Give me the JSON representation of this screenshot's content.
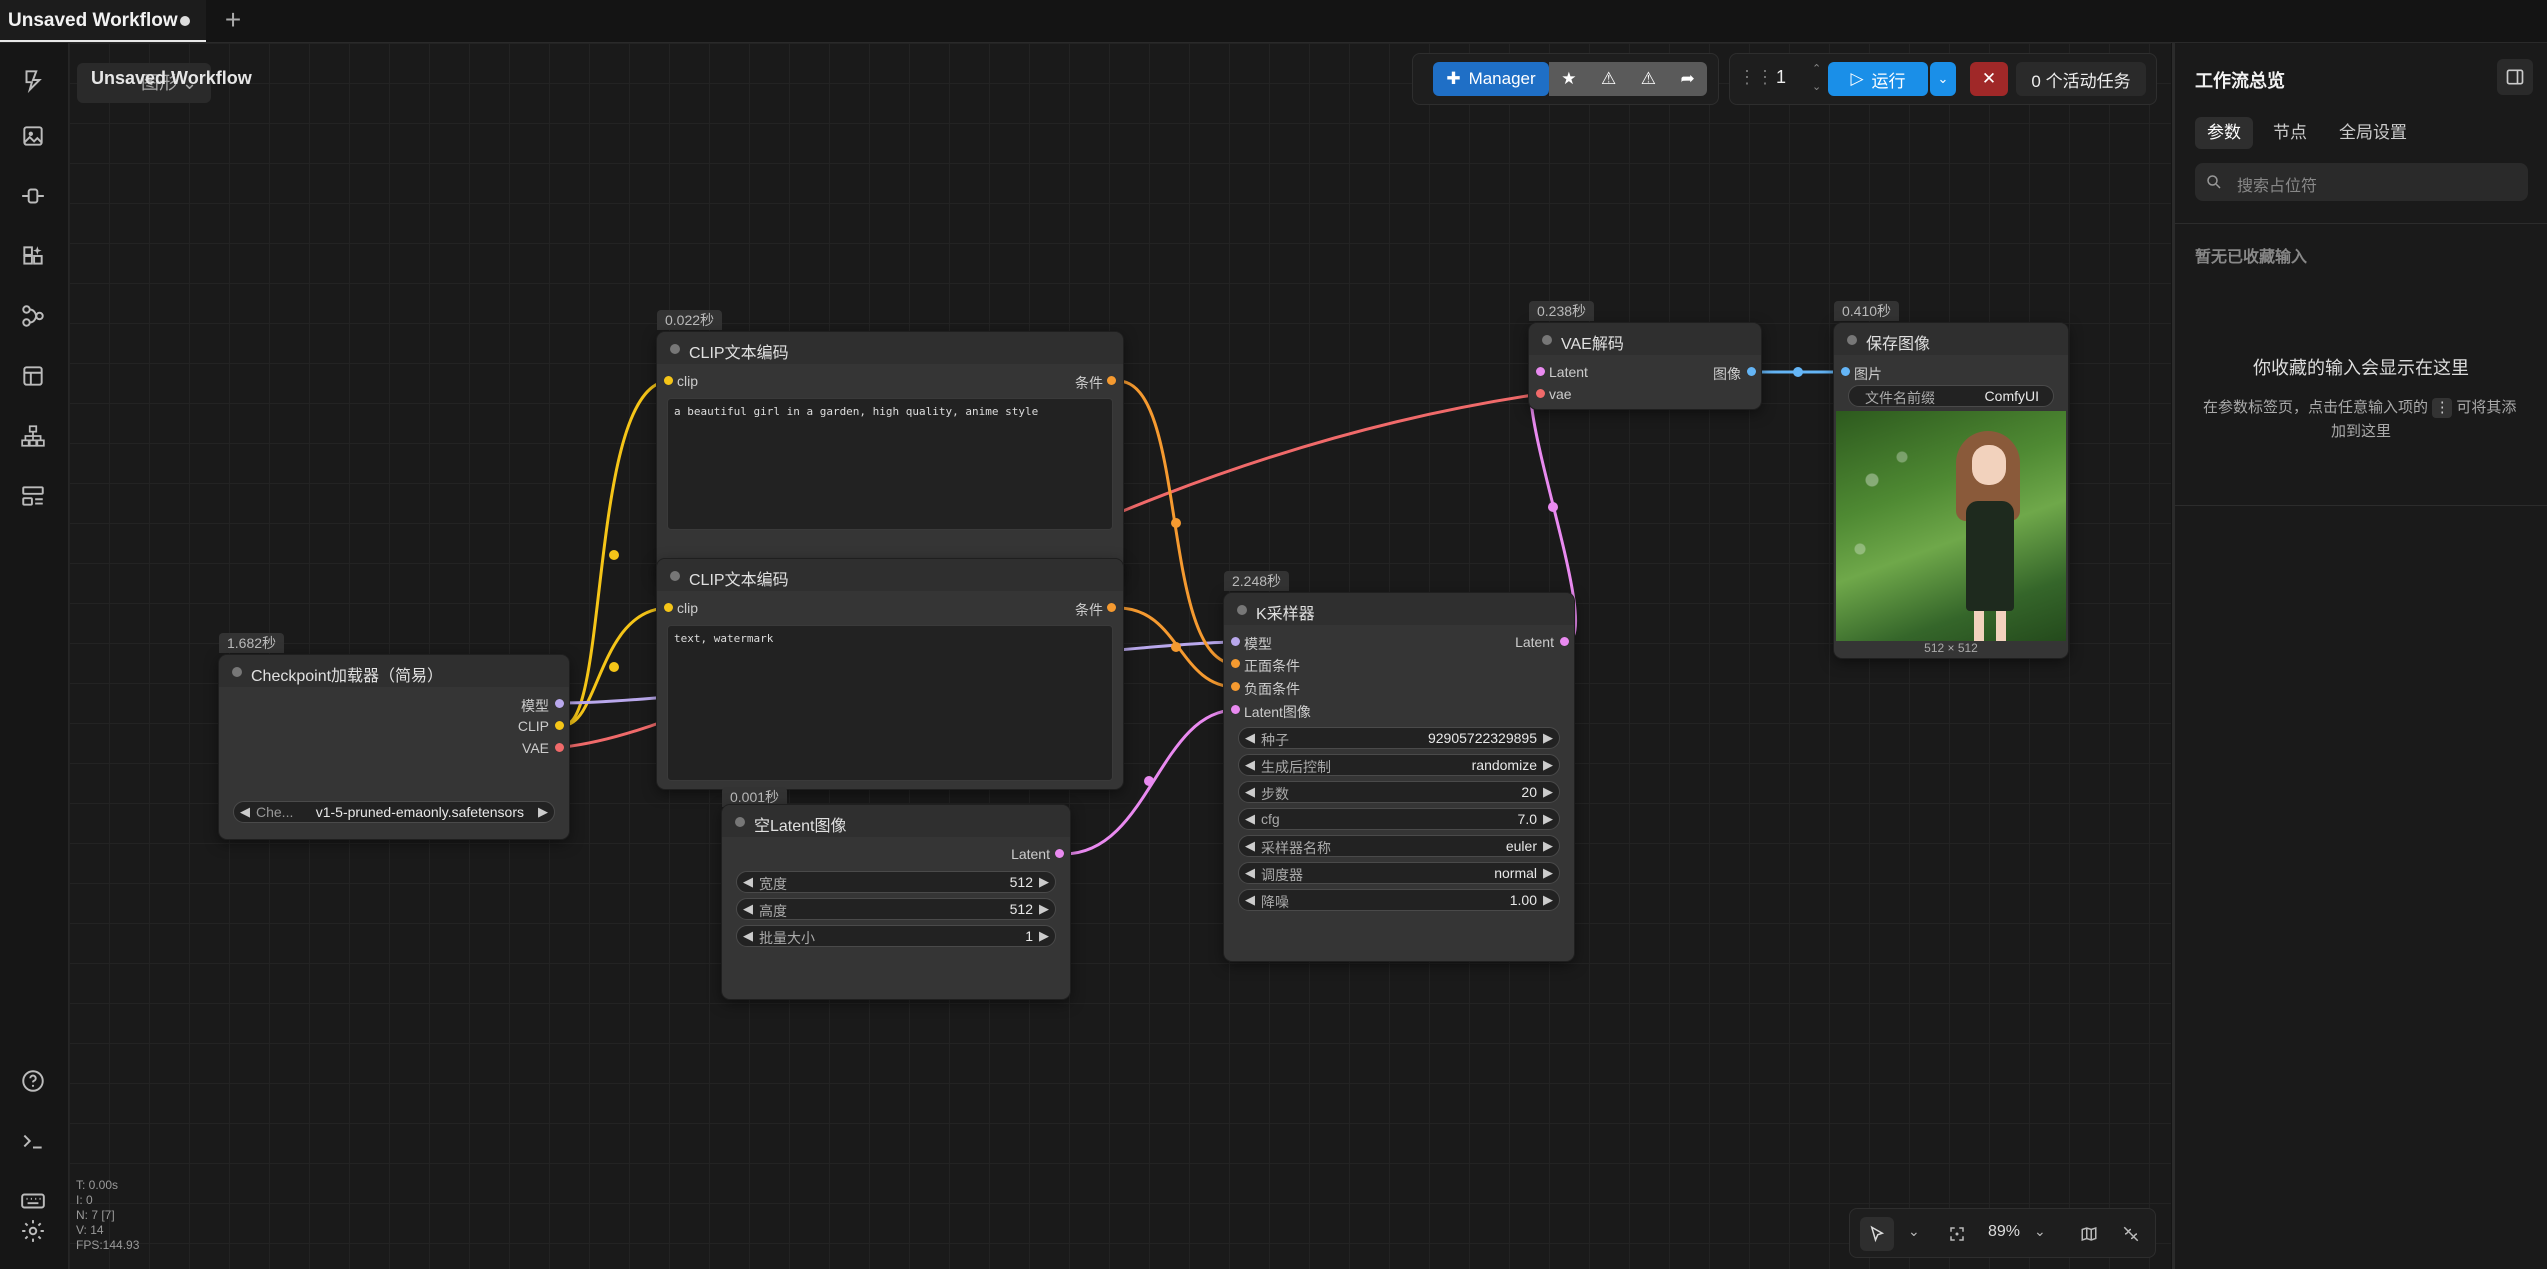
{
  "tabbar": {
    "active_tab": "Unsaved Workflow",
    "add_label": "+"
  },
  "canvas_overlay": {
    "workflow_name": "Unsaved Workflow",
    "ghost_text": "图形"
  },
  "toolbar": {
    "manager_label": "Manager",
    "queue_count": "1",
    "run_label": "运行",
    "active_tasks": "0 个活动任务"
  },
  "nodes": {
    "clip_pos": {
      "badge": "0.022秒",
      "title": "CLIP文本编码",
      "input": "clip",
      "output": "条件",
      "text": "a beautiful girl in a garden, high quality, anime style"
    },
    "clip_neg": {
      "title": "CLIP文本编码",
      "input": "clip",
      "output": "条件",
      "text": "text, watermark"
    },
    "checkpoint": {
      "badge": "1.682秒",
      "title": "Checkpoint加载器（简易）",
      "out_model": "模型",
      "out_clip": "CLIP",
      "out_vae": "VAE",
      "ckpt_label": "Che...",
      "ckpt_value": "v1-5-pruned-emaonly.safetensors"
    },
    "empty_latent": {
      "badge": "0.001秒",
      "title": "空Latent图像",
      "output": "Latent",
      "widgets": [
        {
          "label": "宽度",
          "value": "512"
        },
        {
          "label": "高度",
          "value": "512"
        },
        {
          "label": "批量大小",
          "value": "1"
        }
      ]
    },
    "ksampler": {
      "badge": "2.248秒",
      "title": "K采样器",
      "in_model": "模型",
      "in_pos": "正面条件",
      "in_neg": "负面条件",
      "in_latent": "Latent图像",
      "output": "Latent",
      "widgets": [
        {
          "label": "种子",
          "value": "92905722329895"
        },
        {
          "label": "生成后控制",
          "value": "randomize"
        },
        {
          "label": "步数",
          "value": "20"
        },
        {
          "label": "cfg",
          "value": "7.0"
        },
        {
          "label": "采样器名称",
          "value": "euler"
        },
        {
          "label": "调度器",
          "value": "normal"
        },
        {
          "label": "降噪",
          "value": "1.00"
        }
      ]
    },
    "vae_decode": {
      "badge": "0.238秒",
      "title": "VAE解码",
      "in_latent": "Latent",
      "in_vae": "vae",
      "output": "图像"
    },
    "save_image": {
      "badge": "0.410秒",
      "title": "保存图像",
      "input": "图片",
      "prefix_label": "文件名前缀",
      "prefix_value": "ComfyUI",
      "image_size": "512 × 512"
    }
  },
  "right_panel": {
    "title": "工作流总览",
    "tabs": [
      "参数",
      "节点",
      "全局设置"
    ],
    "search_placeholder": "搜索占位符",
    "empty_heading": "暂无已收藏输入",
    "empty_title": "你收藏的输入会显示在这里",
    "empty_desc_1": "在参数标签页，点击任意输入项的",
    "empty_desc_2": "可将其添",
    "empty_desc_3": "加到这里"
  },
  "stats": {
    "t": "T: 0.00s",
    "i": "I: 0",
    "n": "N: 7 [7]",
    "v": "V: 14",
    "fps": "FPS:144.93"
  },
  "bottom_toolbar": {
    "zoom": "89%"
  },
  "colors": {
    "clip_wire": "#f5c518",
    "conditioning_wire": "#f59a30",
    "vae_wire": "#f06a6a",
    "latent_wire": "#e98af0",
    "image_wire": "#64b5f6",
    "model_wire": "#b9a8ec",
    "run_button": "#1a8fe8",
    "manager_button": "#1f6fc6",
    "stop_button": "#a02828"
  }
}
